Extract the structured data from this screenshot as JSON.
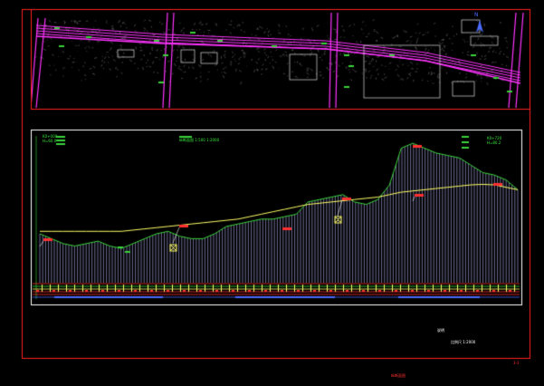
{
  "sheet": {
    "sheet_number": "3-3",
    "title_block": "纵断面图",
    "north_arrow_label": "N"
  },
  "plan_view": {
    "road_name_main": "道路",
    "highlight_box": "detail-area"
  },
  "profile_view": {
    "legend_top_left": [
      "K0+000",
      "H=60.0"
    ],
    "scale_label": "纵断面图 1:500 1:2000",
    "legend_top_right": [
      "K0+720",
      "H=80.2"
    ],
    "notes_label": "说明",
    "notes_scale": "比例尺 1:2000",
    "chart_data": {
      "type": "line",
      "series": [
        {
          "values": [
            60,
            58,
            56,
            55,
            56,
            57,
            55,
            54,
            56,
            58,
            60,
            61,
            59,
            58,
            58,
            60,
            63,
            64,
            65,
            66,
            66,
            67,
            68,
            73,
            74,
            75,
            76,
            73,
            72,
            74,
            80,
            95,
            97,
            95,
            93,
            92,
            91,
            88,
            85,
            84,
            82,
            78
          ]
        },
        {
          "values": [
            61,
            61,
            61,
            61,
            61,
            61,
            61,
            61,
            61.5,
            62,
            62.5,
            63,
            63.5,
            64,
            64.5,
            65,
            65.5,
            66,
            67,
            68,
            69,
            70,
            71,
            72,
            72.5,
            73,
            73.5,
            74,
            74.5,
            75,
            76,
            77,
            77.5,
            78,
            78.5,
            79,
            79.5,
            80,
            80.2,
            80,
            79,
            78
          ]
        }
      ]
    }
  },
  "colors": {
    "frame": "#ff2020",
    "road": "#ff33ff",
    "terrain": "#3ad23a",
    "design": "#ffff66",
    "hatch": "#b9b9ff",
    "background": "#000000"
  }
}
